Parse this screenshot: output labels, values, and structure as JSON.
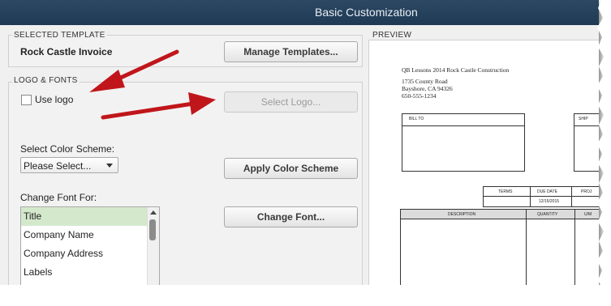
{
  "window": {
    "title": "Basic Customization"
  },
  "selected_template": {
    "section_label": "SELECTED TEMPLATE",
    "template_name": "Rock Castle Invoice",
    "manage_button": "Manage Templates..."
  },
  "logo_fonts": {
    "section_label": "LOGO & FONTS",
    "use_logo_label": "Use logo",
    "use_logo_checked": false,
    "select_logo_button": "Select Logo...",
    "color_scheme_label": "Select Color Scheme:",
    "color_scheme_value": "Please Select...",
    "apply_color_button": "Apply Color Scheme",
    "change_font_label": "Change Font For:",
    "font_items": [
      "Title",
      "Company Name",
      "Company Address",
      "Labels"
    ],
    "selected_font_item": "Title",
    "change_font_button": "Change Font..."
  },
  "preview": {
    "section_label": "PREVIEW",
    "company_line": "QB Lessons 2014 Rock Castle Construction",
    "address_line1": "1735 County Road",
    "address_line2": "Bayshore, CA 94326",
    "phone": "650-555-1234",
    "bill_to": "BILL TO",
    "ship_to": "SHIP",
    "terms": "TERMS",
    "due_date": "DUE DATE",
    "project": "PROJ",
    "due_date_value": "12/15/2015",
    "col_description": "DESCRIPTION",
    "col_quantity": "QUANTITY",
    "col_um": "U/M"
  },
  "colors": {
    "titlebar": "#1f3a55",
    "arrow": "#c0161b",
    "selection": "#d4e9cc"
  }
}
